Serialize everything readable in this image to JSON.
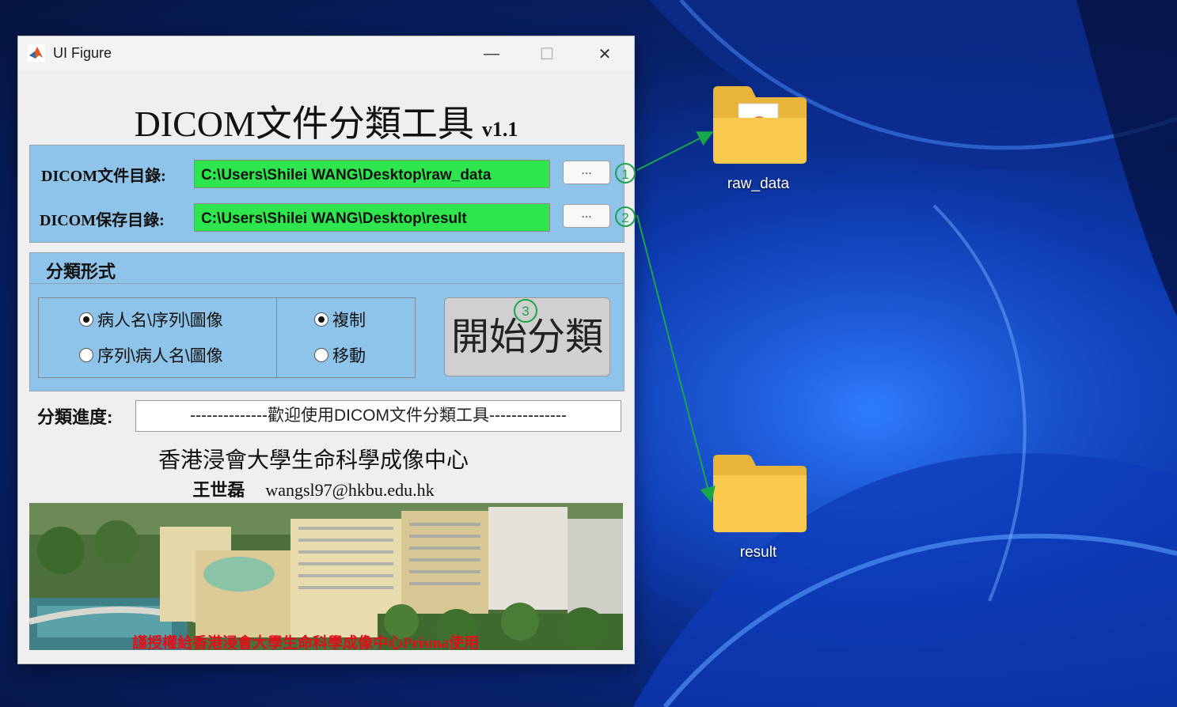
{
  "window": {
    "title": "UI Figure",
    "controls": {
      "minimize": "—",
      "maximize": "☐",
      "close": "✕"
    }
  },
  "app": {
    "title_main": "DICOM文件分類工具",
    "title_version": "v1.1"
  },
  "paths": {
    "source_label": "DICOM文件目錄:",
    "source_value": "C:\\Users\\Shilei WANG\\Desktop\\raw_data",
    "dest_label": "DICOM保存目錄:",
    "dest_value": "C:\\Users\\Shilei WANG\\Desktop\\result",
    "browse_label": "...",
    "step1": "1",
    "step2": "2"
  },
  "classification": {
    "group_title": "分類形式",
    "order_options": [
      {
        "label": "病人名\\序列\\圖像",
        "selected": true
      },
      {
        "label": "序列\\病人名\\圖像",
        "selected": false
      }
    ],
    "mode_options": [
      {
        "label": "複制",
        "selected": true
      },
      {
        "label": "移動",
        "selected": false
      }
    ],
    "start_label": "開始分類",
    "step3": "3"
  },
  "progress": {
    "label": "分類進度:",
    "value": "--------------歡迎使用DICOM文件分類工具--------------"
  },
  "footer": {
    "org_name": "香港浸會大學生命科學成像中心",
    "author": "王世磊",
    "email": "wangsl97@hkbu.edu.hk",
    "photo_caption": "謹授權給香港浸會大學生命科學成像中心Prisma使用"
  },
  "desktop": {
    "icons": [
      {
        "label": "raw_data"
      },
      {
        "label": "result"
      }
    ]
  },
  "colors": {
    "path_field_bg": "#2ee54d",
    "panel_bg": "#8ec4ea",
    "annotation_green": "#19a64a",
    "caption_red": "#e0101a"
  }
}
